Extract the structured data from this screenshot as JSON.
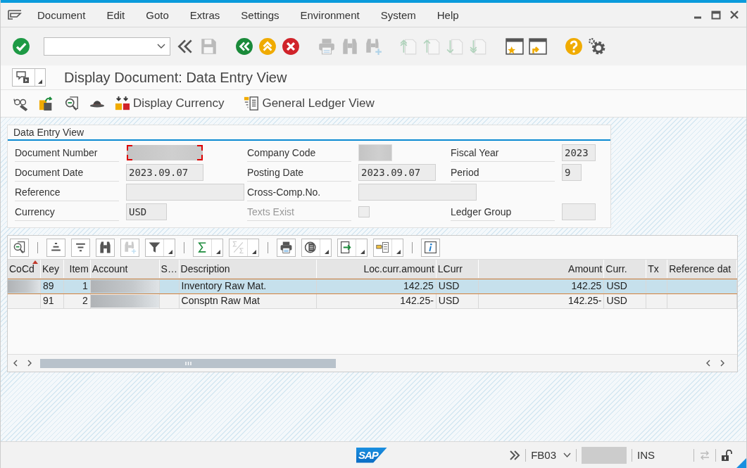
{
  "menu": [
    "Document",
    "Edit",
    "Goto",
    "Extras",
    "Settings",
    "Environment",
    "System",
    "Help"
  ],
  "toolbar": [
    {
      "kind": "enter",
      "disabled": false
    },
    {
      "kind": "command-field"
    },
    {
      "kind": "collapse",
      "disabled": false
    },
    {
      "kind": "save",
      "disabled": true
    },
    {
      "kind": "back",
      "disabled": false
    },
    {
      "kind": "exit",
      "disabled": false
    },
    {
      "kind": "cancel",
      "disabled": false
    },
    {
      "kind": "print",
      "disabled": true
    },
    {
      "kind": "find",
      "disabled": true
    },
    {
      "kind": "find-next",
      "disabled": true
    },
    {
      "kind": "first-page",
      "disabled": true
    },
    {
      "kind": "prev-page",
      "disabled": true
    },
    {
      "kind": "next-page",
      "disabled": true
    },
    {
      "kind": "last-page",
      "disabled": true
    },
    {
      "kind": "new-session",
      "disabled": false
    },
    {
      "kind": "shortcut",
      "disabled": false
    },
    {
      "kind": "help",
      "disabled": false
    },
    {
      "kind": "settings",
      "disabled": false
    }
  ],
  "title": "Display Document: Data Entry View",
  "app_toolbar": [
    {
      "kind": "glasses"
    },
    {
      "kind": "switch"
    },
    {
      "kind": "doc-search"
    },
    {
      "kind": "hat"
    },
    {
      "kind": "currency",
      "label": "Display Currency"
    },
    {
      "kind": "ledger",
      "label": "General Ledger View"
    }
  ],
  "panel": {
    "title": "Data Entry View",
    "rows": [
      [
        {
          "kind": "text",
          "label": "Document Number",
          "redacted": true,
          "focused": true,
          "disabled": false
        },
        {
          "kind": "text",
          "label": "Company Code",
          "redacted": true,
          "focused": false,
          "disabled": false
        },
        {
          "kind": "text",
          "label": "Fiscal Year",
          "value": "2023",
          "redacted": false,
          "focused": false,
          "disabled": false
        }
      ],
      [
        {
          "kind": "text",
          "label": "Document Date",
          "value": "2023.09.07",
          "redacted": false,
          "focused": false,
          "disabled": false
        },
        {
          "kind": "text",
          "label": "Posting Date",
          "value": "2023.09.07",
          "redacted": false,
          "focused": false,
          "disabled": false
        },
        {
          "kind": "text",
          "label": "Period",
          "value": "9",
          "redacted": false,
          "focused": false,
          "disabled": false
        }
      ],
      [
        {
          "kind": "text",
          "label": "Reference",
          "redacted": false,
          "focused": false,
          "disabled": false
        },
        {
          "kind": "text",
          "label": "Cross-Comp.No.",
          "redacted": false,
          "focused": false,
          "disabled": false
        }
      ],
      [
        {
          "kind": "text",
          "label": "Currency",
          "value": "USD",
          "redacted": false,
          "focused": false,
          "disabled": false
        },
        {
          "kind": "checkbox",
          "label": "Texts Exist",
          "checked": false,
          "focused": false,
          "disabled": true
        },
        {
          "kind": "text",
          "label": "Ledger Group",
          "redacted": false,
          "focused": false,
          "disabled": false
        }
      ]
    ]
  },
  "grid": {
    "toolbar": [
      {
        "kind": "details",
        "disabled": false,
        "menu": false
      },
      {
        "kind": "separator"
      },
      {
        "kind": "sort-asc",
        "disabled": false,
        "menu": false
      },
      {
        "kind": "sort-desc",
        "disabled": false,
        "menu": false
      },
      {
        "kind": "find",
        "disabled": false,
        "menu": false
      },
      {
        "kind": "find-next",
        "disabled": true,
        "menu": false
      },
      {
        "kind": "filter",
        "disabled": false,
        "menu": true
      },
      {
        "kind": "separator"
      },
      {
        "kind": "sum",
        "disabled": false,
        "menu": true
      },
      {
        "kind": "subtotal",
        "disabled": true,
        "menu": true
      },
      {
        "kind": "separator"
      },
      {
        "kind": "print",
        "disabled": false,
        "menu": false
      },
      {
        "kind": "views",
        "disabled": false,
        "menu": true
      },
      {
        "kind": "export",
        "disabled": false,
        "menu": true
      },
      {
        "kind": "layout",
        "disabled": false,
        "menu": true
      },
      {
        "kind": "separator"
      },
      {
        "kind": "info",
        "disabled": false,
        "menu": false
      }
    ],
    "columns": [
      {
        "label": "CoCd",
        "sorted": true
      },
      {
        "label": "Key",
        "sorted": false
      },
      {
        "label": "Item",
        "sorted": false
      },
      {
        "label": "Account",
        "sorted": false
      },
      {
        "label": "S…",
        "sorted": false
      },
      {
        "label": "Description",
        "sorted": false
      },
      {
        "label": "Loc.curr.amount",
        "sorted": false
      },
      {
        "label": "LCurr",
        "sorted": false
      },
      {
        "label": "Amount",
        "sorted": false
      },
      {
        "label": "Curr.",
        "sorted": false
      },
      {
        "label": "Tx",
        "sorted": false
      },
      {
        "label": "Reference dat",
        "sorted": false
      }
    ],
    "rows": [
      {
        "selected": true,
        "cells": [
          {
            "kind": "redacted"
          },
          {
            "kind": "text",
            "text": "89"
          },
          {
            "kind": "text",
            "text": "1"
          },
          {
            "kind": "redacted"
          },
          {
            "kind": "empty"
          },
          {
            "kind": "text",
            "text": "Inventory Raw Mat."
          },
          {
            "kind": "text",
            "text": "142.25"
          },
          {
            "kind": "text",
            "text": "USD"
          },
          {
            "kind": "text",
            "text": "142.25"
          },
          {
            "kind": "text",
            "text": "USD"
          },
          {
            "kind": "empty"
          },
          {
            "kind": "empty"
          }
        ]
      },
      {
        "selected": false,
        "cells": [
          {
            "kind": "empty"
          },
          {
            "kind": "text",
            "text": "91"
          },
          {
            "kind": "text",
            "text": "2"
          },
          {
            "kind": "redacted"
          },
          {
            "kind": "empty"
          },
          {
            "kind": "text",
            "text": "Consptn Raw Mat"
          },
          {
            "kind": "text",
            "text": "142.25-"
          },
          {
            "kind": "text",
            "text": "USD"
          },
          {
            "kind": "text",
            "text": "142.25-"
          },
          {
            "kind": "text",
            "text": "USD"
          },
          {
            "kind": "empty"
          },
          {
            "kind": "empty"
          }
        ]
      }
    ]
  },
  "status_bar": {
    "logo": "SAP",
    "transaction": "FB03",
    "mode": "INS"
  }
}
